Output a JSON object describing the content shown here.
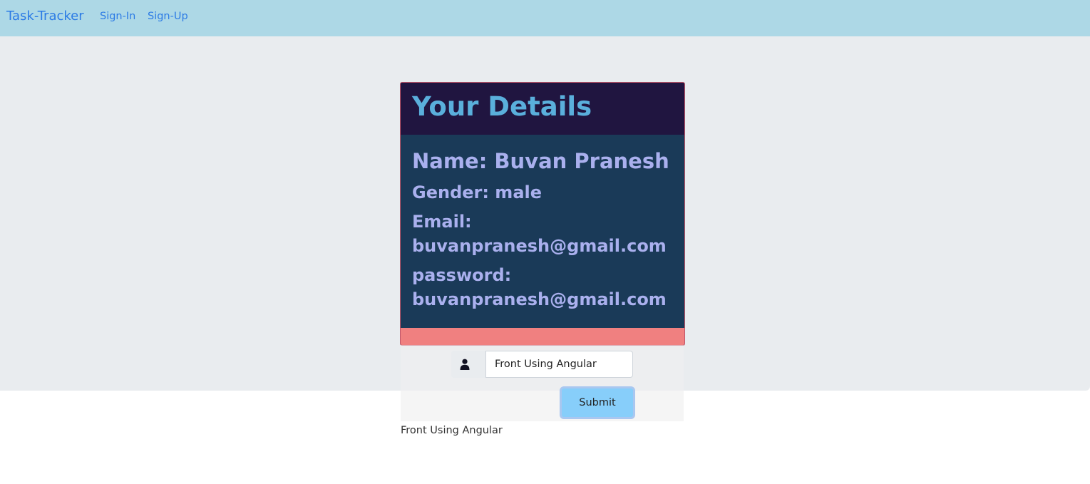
{
  "navbar": {
    "brand": "Task-Tracker",
    "links": [
      "Sign-In",
      "Sign-Up"
    ],
    "background": "#add8e6",
    "link_color": "#2c7be5"
  },
  "card": {
    "title": "Your Details",
    "details": {
      "name": "Name: Buvan Pranesh",
      "gender": "Gender: male",
      "email_label": "Email:",
      "email_value": "buvanpranesh@gmail.com",
      "password_label": "password:",
      "password_value": "buvanpranesh@gmail.com"
    },
    "header_color": "#201540",
    "body_color": "#1a3a58",
    "footer_color": "#f08080",
    "title_color": "#5aafdc",
    "text_color": "#aab0ee"
  },
  "form": {
    "icon": "user-icon",
    "input_value": "Front Using Angular",
    "submit_label": "Submit",
    "submit_color": "#87cefa"
  },
  "output": {
    "text": "Front Using Angular"
  }
}
